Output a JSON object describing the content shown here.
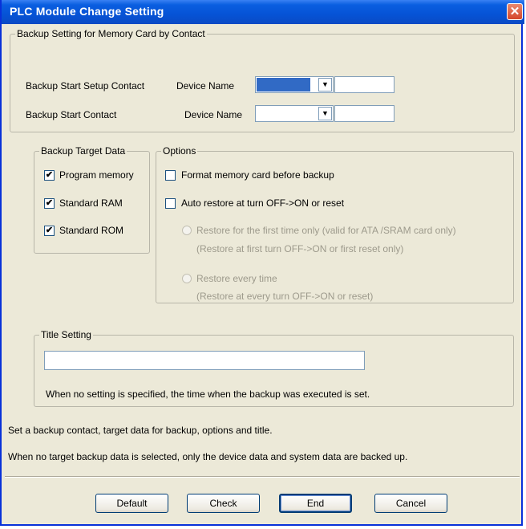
{
  "window": {
    "title": "PLC Module Change Setting",
    "close_glyph": "✕"
  },
  "backup_setting": {
    "legend": "Backup Setting for Memory Card by Contact",
    "setup_contact_label": "Backup Start Setup Contact",
    "start_contact_label": "Backup Start Contact",
    "device_name_label_1": "Device Name",
    "device_name_label_2": "Device Name",
    "setup_device_value": "",
    "setup_device_number": "",
    "start_device_value": "",
    "start_device_number": ""
  },
  "target_data": {
    "legend": "Backup Target Data",
    "items": [
      {
        "label": "Program memory",
        "checked": true
      },
      {
        "label": "Standard RAM",
        "checked": true
      },
      {
        "label": "Standard ROM",
        "checked": true
      }
    ]
  },
  "options": {
    "legend": "Options",
    "format_label": "Format memory card before backup",
    "format_checked": false,
    "auto_restore_label": "Auto restore at turn OFF->ON or reset",
    "auto_restore_checked": false,
    "restore_first_label": "Restore for the first time only (valid for ATA /SRAM card only)",
    "restore_first_sub": "(Restore at first turn OFF->ON or first reset only)",
    "restore_every_label": "Restore every time",
    "restore_every_sub": "(Restore at every turn OFF->ON or reset)"
  },
  "title_setting": {
    "legend": "Title Setting",
    "value": "",
    "note": "When no setting is specified, the time when the backup was executed is set."
  },
  "info": {
    "line1": "Set a backup contact, target data for backup, options and title.",
    "line2": "When no target backup data is selected, only the device data and system data are backed up."
  },
  "buttons": {
    "default": "Default",
    "check": "Check",
    "end": "End",
    "cancel": "Cancel"
  },
  "icons": {
    "checkmark": "✔",
    "dropdown": "▼"
  },
  "colors": {
    "titlebar": "#0653d6",
    "dialog_bg": "#ece9d8",
    "selection": "#316ac5"
  }
}
